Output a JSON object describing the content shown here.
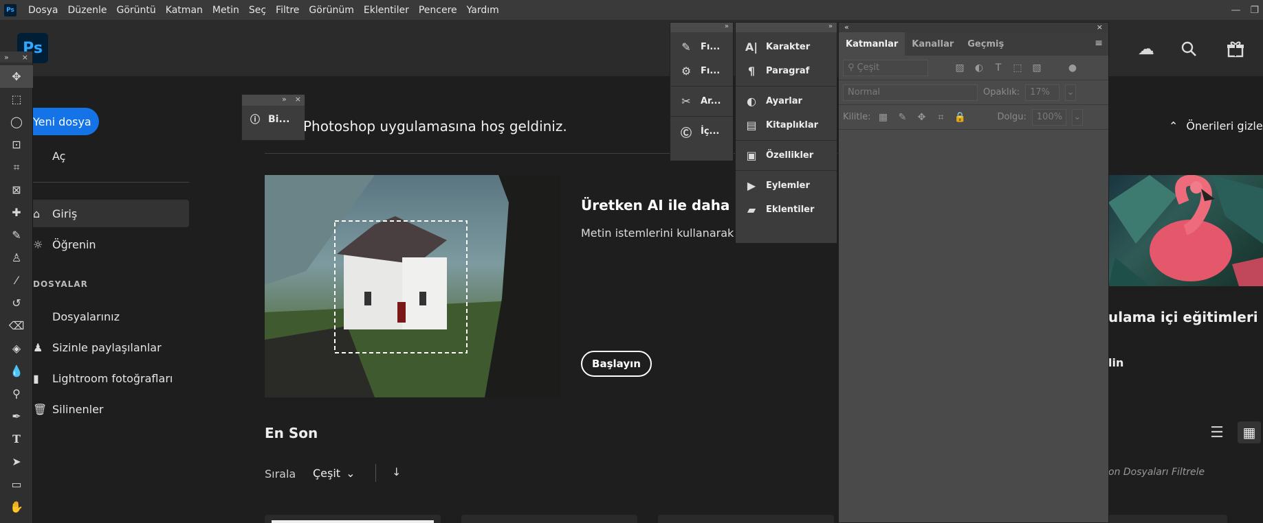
{
  "menubar": {
    "app_badge": "Ps",
    "items": [
      "Dosya",
      "Düzenle",
      "Görüntü",
      "Katman",
      "Metin",
      "Seç",
      "Filtre",
      "Görünüm",
      "Eklentiler",
      "Pencere",
      "Yardım"
    ]
  },
  "header": {
    "logo_text": "Ps",
    "icons": [
      "cloud-icon",
      "search-icon",
      "gift-icon"
    ]
  },
  "toolbar": {
    "collapse_glyph": "»",
    "close_glyph": "×",
    "tools": [
      "move",
      "marquee",
      "lasso",
      "object-select",
      "crop",
      "frame",
      "healing",
      "brush",
      "stamp",
      "eyedropper",
      "history-brush",
      "eraser",
      "paint-bucket",
      "blur",
      "dodge",
      "pen",
      "type",
      "path-select",
      "rectangle",
      "hand"
    ]
  },
  "sidebar": {
    "new_file": "Yeni dosya",
    "open": "Aç",
    "home": "Giriş",
    "learn": "Öğrenin",
    "files_heading": "DOSYALAR",
    "your_files": "Dosyalarınız",
    "shared": "Sizinle paylaşılanlar",
    "lightroom": "Lightroom fotoğrafları",
    "deleted": "Silinenler"
  },
  "float_panel": {
    "label": "Bi..."
  },
  "main": {
    "welcome": "Photoshop uygulamasına hoş geldiniz.",
    "hide_suggestions": "Önerileri gizle",
    "hero": {
      "title": "Üretken AI ile daha büyü",
      "desc": "Metin istemlerini kullanarak gör kaldırın.",
      "button": "Başlayın"
    },
    "tutorial": {
      "title": "ulama içi eğitimleri",
      "link": "lin"
    },
    "recent": {
      "heading": "En Son",
      "sort_label": "Sırala",
      "sort_value": "Çeşit",
      "filter_placeholder": "on Dosyaları Filtrele"
    }
  },
  "dock": {
    "col1": [
      "Fı...",
      "Fı...",
      "Ar...",
      "İç..."
    ],
    "col2": [
      "Karakter",
      "Paragraf",
      "Ayarlar",
      "Kitaplıklar",
      "Özellikler",
      "Eylemler",
      "Eklentiler"
    ]
  },
  "layers": {
    "tabs": [
      "Katmanlar",
      "Kanallar",
      "Geçmiş"
    ],
    "filter_placeholder": "Çeşit",
    "blend_mode": "Normal",
    "opacity_label": "Opaklık:",
    "opacity_value": "17%",
    "lock_label": "Kilitle:",
    "fill_label": "Dolgu:",
    "fill_value": "100%"
  }
}
